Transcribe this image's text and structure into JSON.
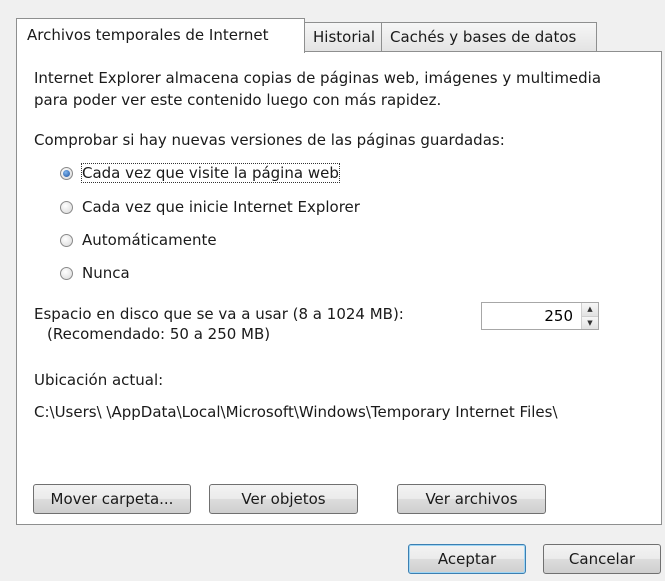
{
  "tabs": [
    {
      "label": "Archivos temporales de Internet",
      "active": true
    },
    {
      "label": "Historial",
      "active": false
    },
    {
      "label": "Cachés y bases de datos",
      "active": false
    }
  ],
  "description": "Internet Explorer almacena copias de páginas web, imágenes y multimedia para poder ver este contenido luego con más rapidez.",
  "check_question": "Comprobar si hay nuevas versiones de las páginas guardadas:",
  "options": [
    {
      "label": "Cada vez que visite la página web",
      "checked": true
    },
    {
      "label": "Cada vez que inicie Internet Explorer",
      "checked": false
    },
    {
      "label": "Automáticamente",
      "checked": false
    },
    {
      "label": "Nunca",
      "checked": false
    }
  ],
  "disk": {
    "label": "Espacio en disco que se va a usar (8 a 1024 MB):",
    "recommended": "(Recomendado: 50 a 250 MB)",
    "value": "250"
  },
  "location": {
    "label": "Ubicación actual:",
    "path": "C:\\Users\\        \\AppData\\Local\\Microsoft\\Windows\\Temporary Internet Files\\"
  },
  "buttons": {
    "move": "Mover carpeta...",
    "objects": "Ver objetos",
    "files": "Ver archivos",
    "ok": "Aceptar",
    "cancel": "Cancelar"
  },
  "icons": {
    "spin_up": "spin-up-icon",
    "spin_down": "spin-down-icon"
  }
}
